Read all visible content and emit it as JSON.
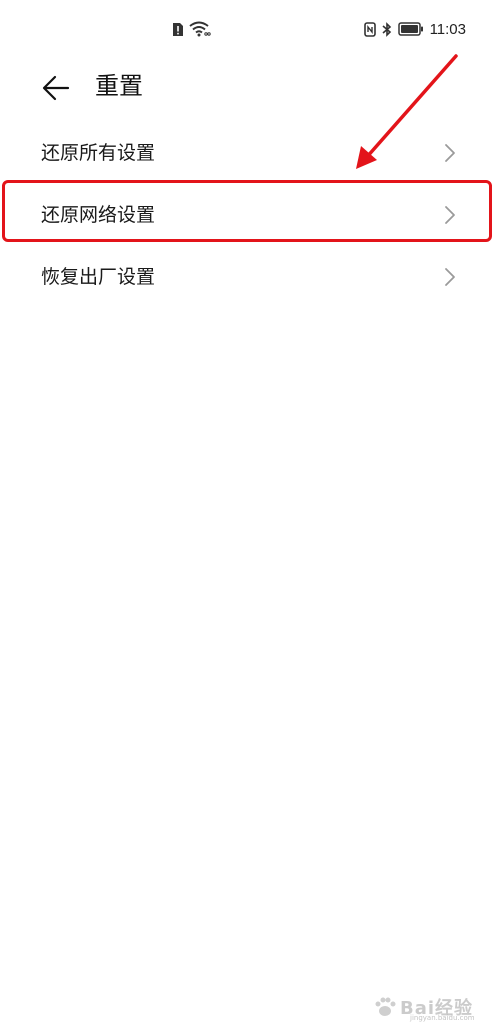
{
  "status_bar": {
    "time": "11:03",
    "left_icons": [
      "sim-alert-icon",
      "wifi-icon"
    ],
    "right_icons": [
      "nfc-icon",
      "bluetooth-icon",
      "battery-icon"
    ]
  },
  "header": {
    "back_icon": "arrow-left-icon",
    "title": "重置"
  },
  "menu": {
    "items": [
      {
        "label": "还原所有设置",
        "icon": "chevron-right-icon"
      },
      {
        "label": "还原网络设置",
        "icon": "chevron-right-icon",
        "highlighted": true
      },
      {
        "label": "恢复出厂设置",
        "icon": "chevron-right-icon"
      }
    ]
  },
  "annotation": {
    "color": "#e3141a"
  },
  "watermark": {
    "text": "Bai经验",
    "sub": "jingyan.baidu.com"
  }
}
